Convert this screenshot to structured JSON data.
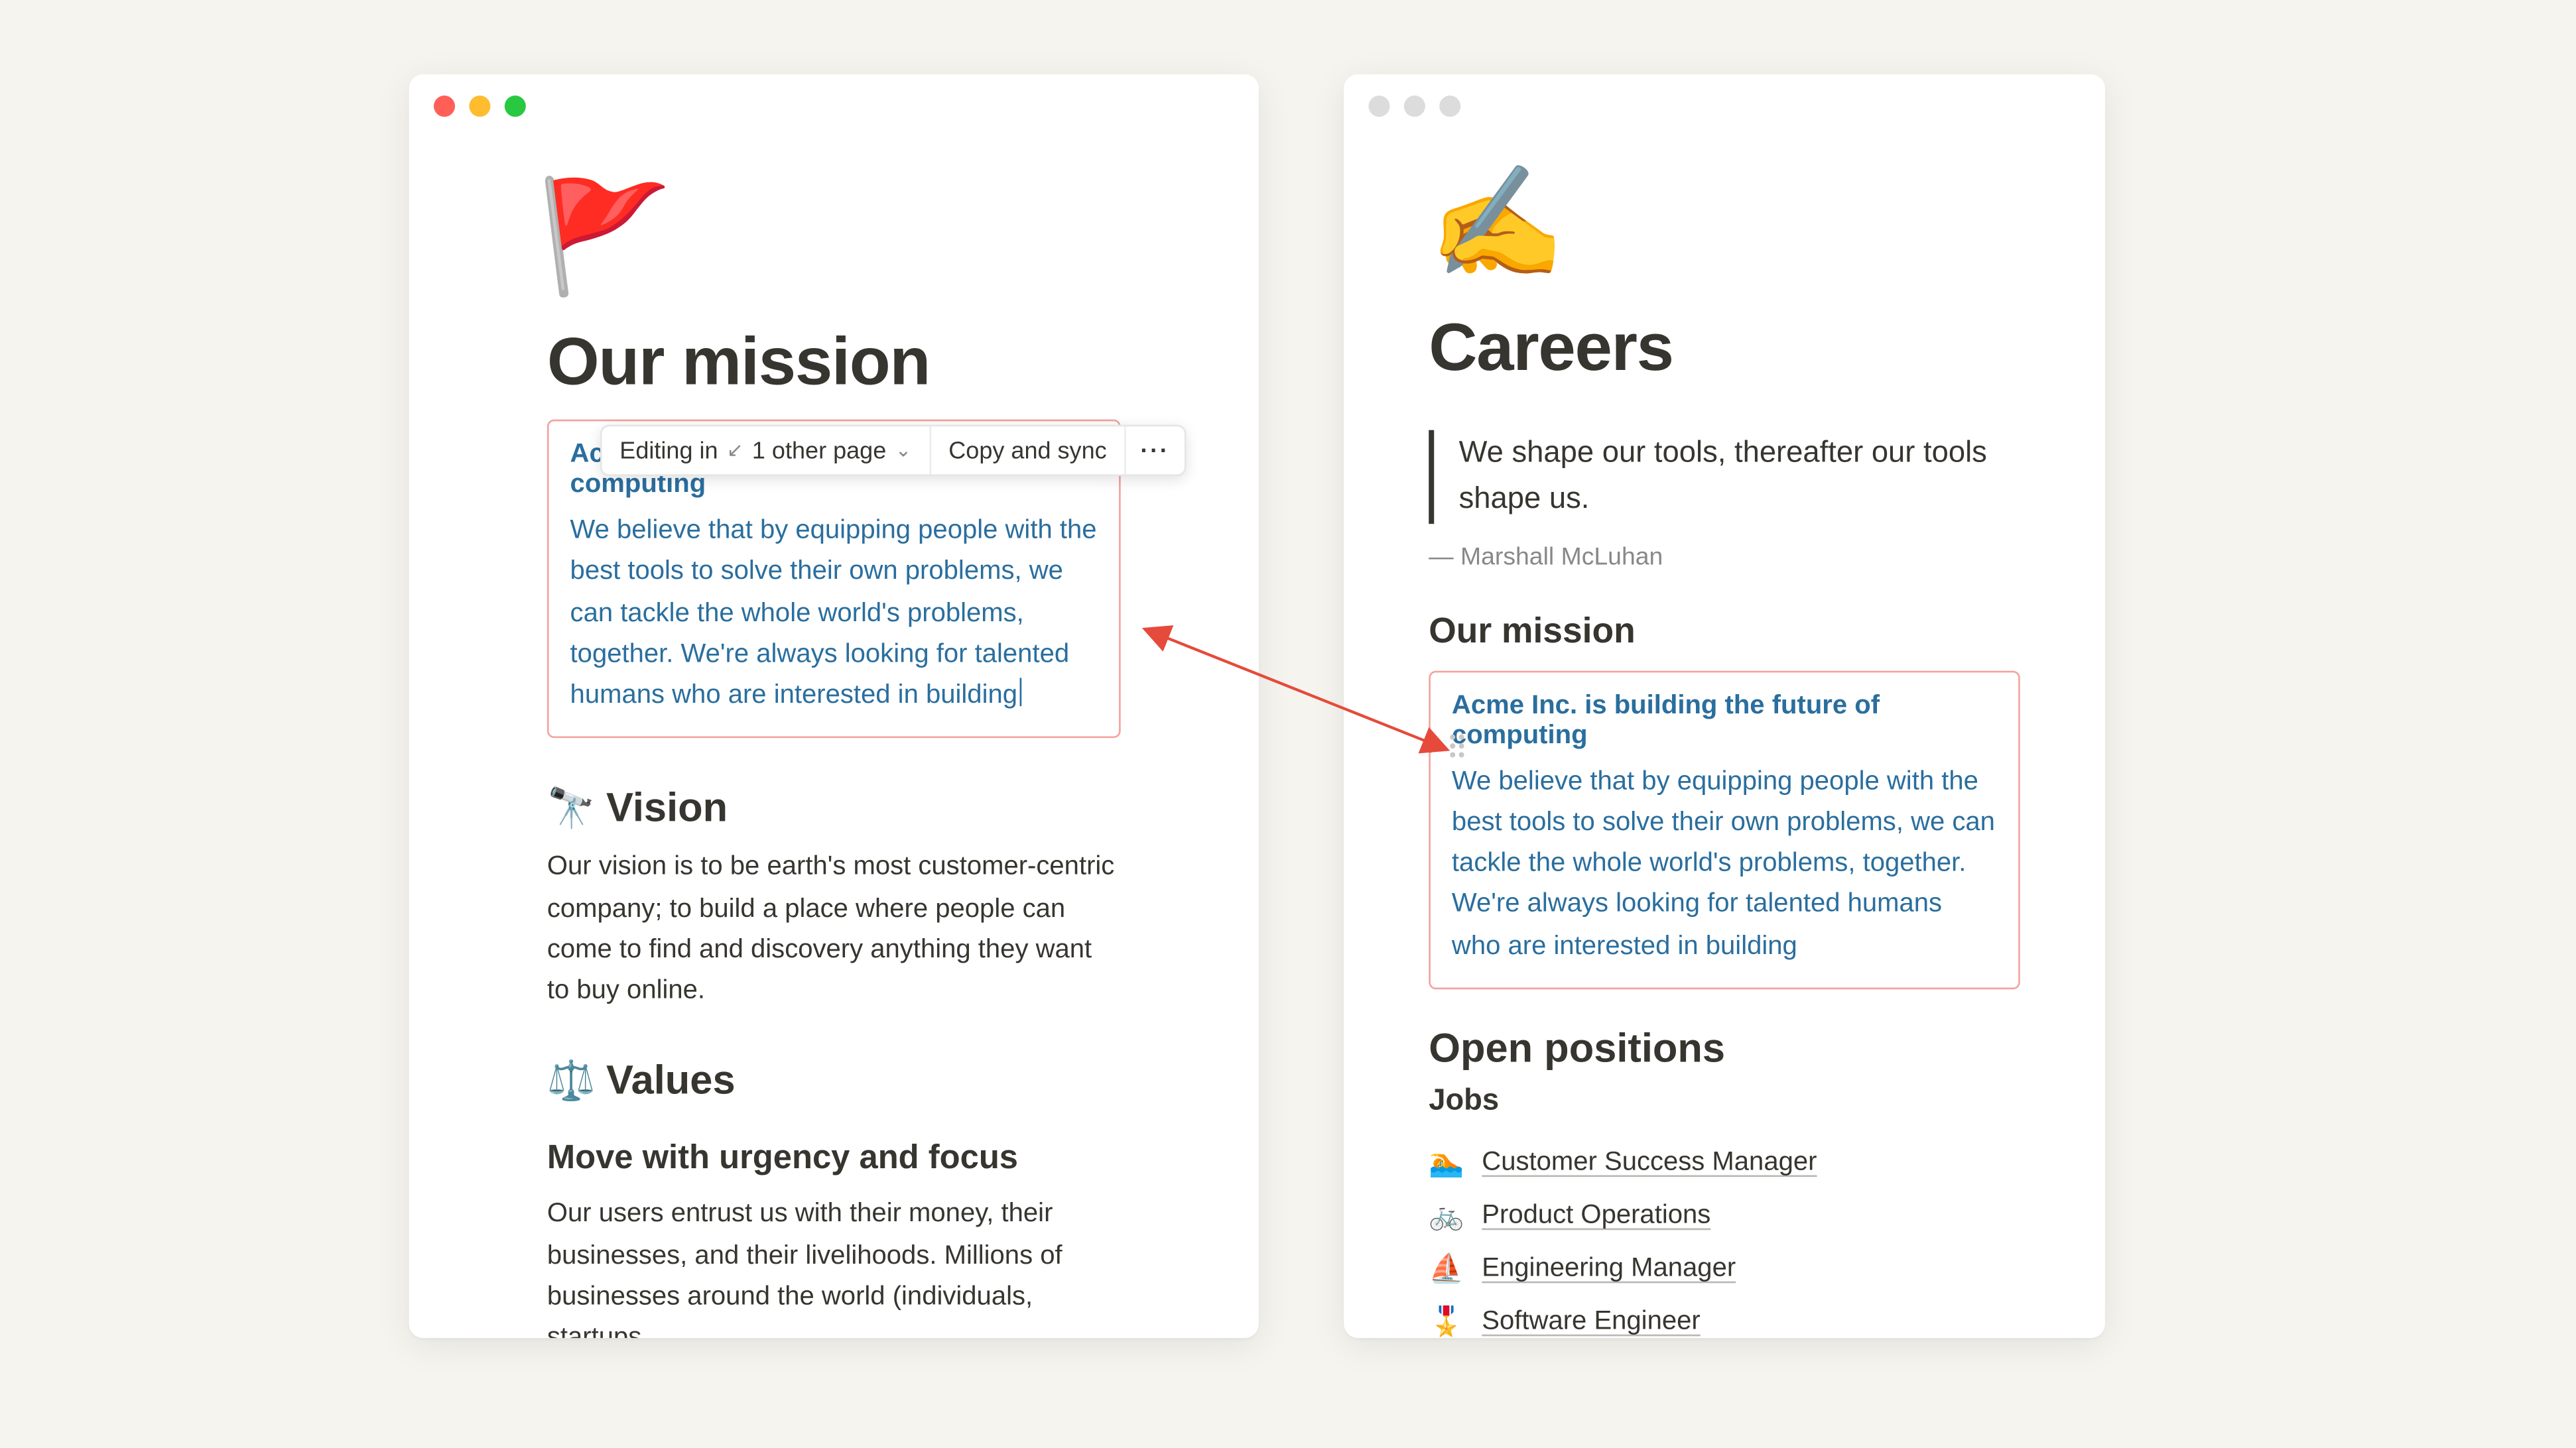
{
  "left": {
    "emoji": "🚩",
    "title": "Our mission",
    "synced": {
      "bold": "Acme Inc. is building the future of computing",
      "body": "We believe that by equipping people with the best tools to solve their own problems, we can tackle the whole world's problems, together. We're always looking for talented humans who are interested in building"
    },
    "vision": {
      "icon": "🔭",
      "heading": "Vision",
      "body": "Our vision is to be earth's most customer-centric company; to build a place where people can come to find and discovery anything they want to buy online."
    },
    "values": {
      "icon": "⚖️",
      "heading": "Values",
      "sub": "Move with urgency and focus",
      "body": "Our users entrust us with their money, their businesses, and their livelihoods. Millions of businesses around the world (individuals, startups,"
    }
  },
  "toolbar": {
    "editing_prefix": "Editing in",
    "editing_count": "1 other page",
    "copy_sync": "Copy and sync",
    "more": "···"
  },
  "right": {
    "emoji": "✍️",
    "title": "Careers",
    "quote": "We shape our tools, thereafter our tools shape us.",
    "quote_attrib": "— Marshall McLuhan",
    "mission_heading": "Our mission",
    "synced": {
      "bold": "Acme Inc. is building the future of computing",
      "body": "We believe that by equipping people with the best tools to solve their own problems, we can tackle the whole world's problems, together. We're always looking for talented humans who are interested in building"
    },
    "open_positions": "Open positions",
    "jobs_heading": "Jobs",
    "jobs": [
      {
        "emoji": "🏊",
        "label": "Customer Success Manager"
      },
      {
        "emoji": "🚲",
        "label": "Product Operations"
      },
      {
        "emoji": "⛵",
        "label": "Engineering Manager"
      },
      {
        "emoji": "🎖️",
        "label": "Software Engineer"
      }
    ]
  }
}
